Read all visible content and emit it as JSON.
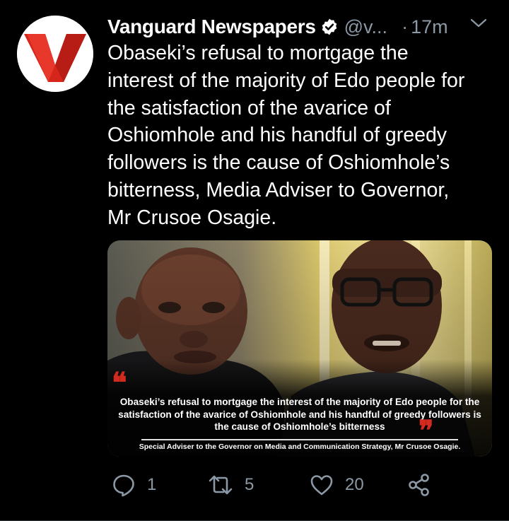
{
  "tweet": {
    "author": {
      "display_name": "Vanguard Newspapers",
      "handle": "@v...",
      "verified": true,
      "avatar_icon": "vanguard-v-logo",
      "avatar_letter": "V"
    },
    "dot": "·",
    "time": "17m",
    "menu_icon": "chevron-down-icon",
    "text": "Obaseki’s refusal to mortgage the\ninterest of the majority of Edo people for\nthe satisfaction of the avarice of\nOshiomhole and his handful of greedy\nfollowers is the cause of Oshiomhole’s\nbitterness, Media Adviser to Governor,\nMr Crusoe Osagie.",
    "media": {
      "quote_open": "❝",
      "quote_close": "❞",
      "quote": "Obaseki’s refusal to mortgage the interest of the majority of Edo people for the satisfaction of the avarice of Oshiomhole and his handful of greedy followers is the cause of Oshiomhole’s bitterness",
      "credit": "Special Adviser to the Governor on Media and Communication Strategy, Mr Crusoe Osagie."
    },
    "actions": {
      "reply": {
        "icon": "reply-icon",
        "count": "1"
      },
      "retweet": {
        "icon": "retweet-icon",
        "count": "5"
      },
      "like": {
        "icon": "heart-icon",
        "count": "20"
      },
      "share": {
        "icon": "share-icon"
      }
    }
  },
  "colors": {
    "background": "#000000",
    "text": "#ffffff",
    "secondary": "#8b98a5",
    "verified": "#ffffff",
    "brand_red": "#d32a1f"
  }
}
